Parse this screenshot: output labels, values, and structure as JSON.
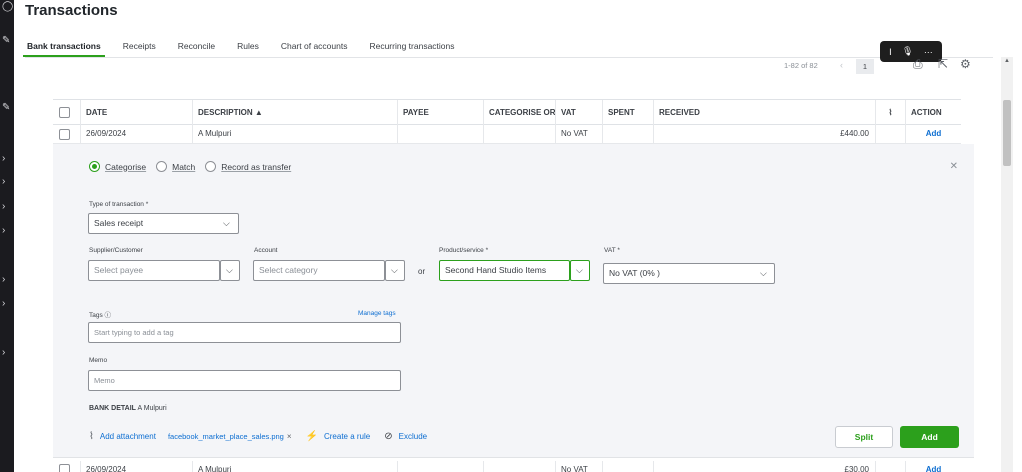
{
  "page": {
    "title": "Transactions"
  },
  "tabs": [
    {
      "label": "Bank transactions",
      "active": true
    },
    {
      "label": "Receipts"
    },
    {
      "label": "Reconcile"
    },
    {
      "label": "Rules"
    },
    {
      "label": "Chart of accounts"
    },
    {
      "label": "Recurring transactions"
    }
  ],
  "toolbar": {
    "icons": [
      "cursor-icon",
      "microphone-icon",
      "more-icon"
    ],
    "more_label": "···"
  },
  "pager": {
    "range": "1-82 of 82",
    "current": "1"
  },
  "table": {
    "headers": {
      "date": "DATE",
      "description": "DESCRIPTION ▲",
      "payee": "PAYEE",
      "categorise": "CATEGORISE OR MATCH",
      "vat": "VAT",
      "spent": "SPENT",
      "received": "RECEIVED",
      "action": "ACTION"
    },
    "rows": [
      {
        "date": "26/09/2024",
        "description": "A Mulpuri",
        "payee": "",
        "categorise": "",
        "vat": "No VAT",
        "spent": "",
        "received": "£440.00",
        "action": "Add"
      },
      {
        "date": "26/09/2024",
        "description": "A Mulpuri",
        "payee": "",
        "categorise": "",
        "vat": "No VAT",
        "spent": "",
        "received": "£30.00",
        "action": "Add"
      }
    ]
  },
  "panel": {
    "radios": [
      {
        "label": "Categorise",
        "selected": true
      },
      {
        "label": "Match",
        "selected": false
      },
      {
        "label": "Record as transfer",
        "selected": false
      }
    ],
    "type_label": "Type of transaction *",
    "type_value": "Sales receipt",
    "supplier_label": "Supplier/Customer",
    "supplier_placeholder": "Select payee",
    "account_label": "Account",
    "account_placeholder": "Select category",
    "or_text": "or",
    "product_label": "Product/service *",
    "product_value": "Second Hand Studio Items",
    "vat_label": "VAT *",
    "vat_value": "No VAT (0% )",
    "tags_label": "Tags",
    "manage_tags": "Manage tags",
    "tags_placeholder": "Start typing to add a tag",
    "memo_label": "Memo",
    "memo_placeholder": "Memo",
    "bank_detail_label": "BANK DETAIL",
    "bank_detail_value": "A Mulpuri",
    "add_attachment": "Add attachment",
    "attachment_file": "facebook_market_place_sales.png",
    "create_rule": "Create a rule",
    "exclude": "Exclude",
    "split_label": "Split",
    "add_label": "Add"
  },
  "colors": {
    "accent": "#2ca01c",
    "link": "#0d6ed1",
    "panel_bg": "#f4f5f8"
  }
}
